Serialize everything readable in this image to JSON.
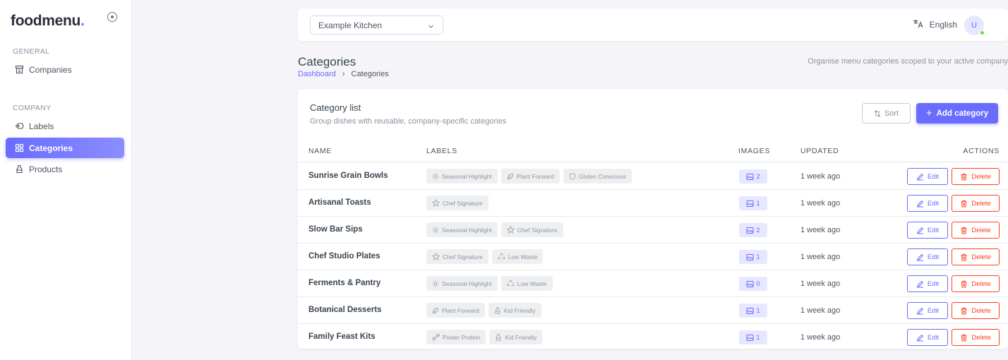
{
  "brand": {
    "name": "foodmenu",
    "dot": "."
  },
  "sidebar": {
    "sections": [
      {
        "label": "GENERAL",
        "items": [
          {
            "label": "Companies",
            "icon": "building-icon",
            "active": false
          }
        ]
      },
      {
        "label": "COMPANY",
        "items": [
          {
            "label": "Labels",
            "icon": "tag-icon",
            "active": false
          },
          {
            "label": "Categories",
            "icon": "grid-icon",
            "active": true
          },
          {
            "label": "Products",
            "icon": "bottle-icon",
            "active": false
          }
        ]
      }
    ]
  },
  "topbar": {
    "kitchen": "Example Kitchen",
    "language": "English",
    "avatar_initial": "U"
  },
  "page": {
    "title": "Categories",
    "breadcrumb_root": "Dashboard",
    "breadcrumb_sep": "›",
    "breadcrumb_current": "Categories",
    "description": "Organise menu categories scoped to your active company"
  },
  "card": {
    "title": "Category list",
    "subtitle": "Group dishes with reusable, company-specific categories",
    "sort_label": "Sort",
    "add_label": "Add category"
  },
  "table": {
    "headers": {
      "name": "NAME",
      "labels": "LABELS",
      "images": "IMAGES",
      "updated": "UPDATED",
      "actions": "ACTIONS"
    },
    "edit_label": "Edit",
    "delete_label": "Delete",
    "rows": [
      {
        "name": "Sunrise Grain Bowls",
        "labels": [
          {
            "text": "Seasonal Highlight",
            "icon": "sun-icon"
          },
          {
            "text": "Plant Forward",
            "icon": "leaf-icon"
          },
          {
            "text": "Gluten Conscious",
            "icon": "shield-icon"
          }
        ],
        "images": "2",
        "updated": "1 week ago"
      },
      {
        "name": "Artisanal Toasts",
        "labels": [
          {
            "text": "Chef Signature",
            "icon": "star-icon"
          }
        ],
        "images": "1",
        "updated": "1 week ago"
      },
      {
        "name": "Slow Bar Sips",
        "labels": [
          {
            "text": "Seasonal Highlight",
            "icon": "sun-icon"
          },
          {
            "text": "Chef Signature",
            "icon": "star-icon"
          }
        ],
        "images": "2",
        "updated": "1 week ago"
      },
      {
        "name": "Chef Studio Plates",
        "labels": [
          {
            "text": "Chef Signature",
            "icon": "star-icon"
          },
          {
            "text": "Low Waste",
            "icon": "recycle-icon"
          }
        ],
        "images": "1",
        "updated": "1 week ago"
      },
      {
        "name": "Ferments & Pantry",
        "labels": [
          {
            "text": "Seasonal Highlight",
            "icon": "sun-icon"
          },
          {
            "text": "Low Waste",
            "icon": "recycle-icon"
          }
        ],
        "images": "0",
        "updated": "1 week ago"
      },
      {
        "name": "Botanical Desserts",
        "labels": [
          {
            "text": "Plant Forward",
            "icon": "leaf-icon"
          },
          {
            "text": "Kid Friendly",
            "icon": "bottle-icon"
          }
        ],
        "images": "1",
        "updated": "1 week ago"
      },
      {
        "name": "Family Feast Kits",
        "labels": [
          {
            "text": "Power Protein",
            "icon": "dumbbell-icon"
          },
          {
            "text": "Kid Friendly",
            "icon": "bottle-icon"
          }
        ],
        "images": "1",
        "updated": "1 week ago"
      }
    ]
  },
  "colors": {
    "accent": "#696cff",
    "danger": "#ff3e1d",
    "online": "#71dd37"
  }
}
